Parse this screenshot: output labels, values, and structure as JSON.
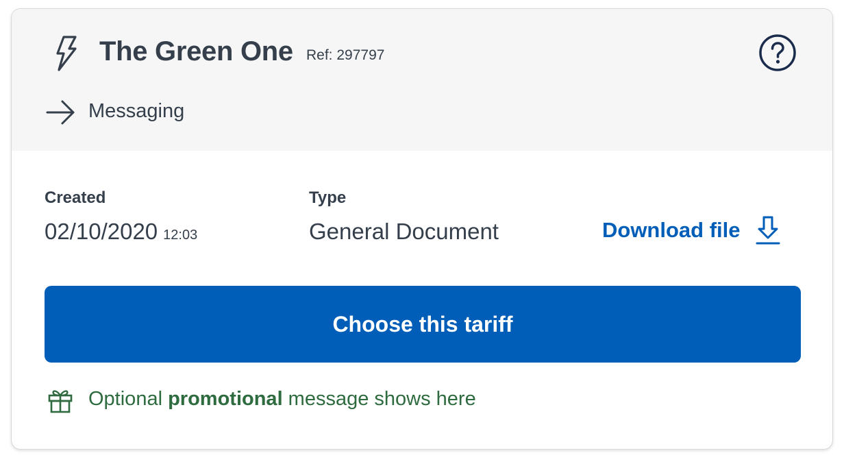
{
  "card": {
    "title": "The Green One",
    "ref": "Ref: 297797",
    "category_label": "Messaging",
    "icons": {
      "tariff": "lightning-bolt-icon",
      "help": "question-circle-icon",
      "category": "arrow-right-icon",
      "download": "download-icon",
      "promo": "gift-icon"
    }
  },
  "details": {
    "created_label": "Created",
    "created_date": "02/10/2020",
    "created_time": "12:03",
    "type_label": "Type",
    "type_value": "General Document",
    "download_label": "Download file"
  },
  "cta": {
    "label": "Choose this tariff"
  },
  "promo": {
    "prefix": "Optional ",
    "highlight": "promotional",
    "suffix": " message shows here"
  },
  "colors": {
    "primary": "#005eb8",
    "text": "#343f4b",
    "promo": "#2e6b3f",
    "header_bg": "#f6f6f6"
  }
}
